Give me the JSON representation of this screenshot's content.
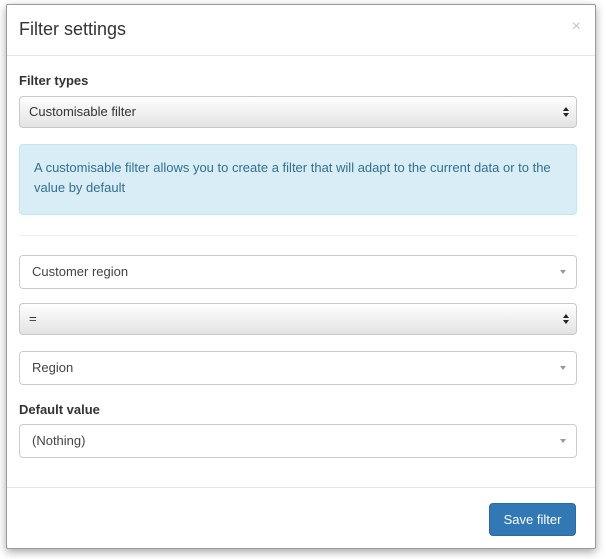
{
  "modal": {
    "title": "Filter settings",
    "close_label": "×"
  },
  "filter_types": {
    "label": "Filter types",
    "selected": "Customisable filter"
  },
  "info": {
    "text": "A customisable filter allows you to create a filter that will adapt to the current data or to the value by default"
  },
  "field": {
    "selected": "Customer region"
  },
  "operator": {
    "selected": "="
  },
  "value_source": {
    "selected": "Region"
  },
  "default_value": {
    "label": "Default value",
    "selected": "(Nothing)"
  },
  "footer": {
    "save_label": "Save filter"
  },
  "colors": {
    "primary": "#3278b5",
    "info_bg": "#d9edf7",
    "info_text": "#31708f"
  },
  "icons": {
    "close": "close-icon",
    "select_arrows": "up-down-arrows-icon",
    "dropdown_caret": "chevron-down-icon"
  }
}
